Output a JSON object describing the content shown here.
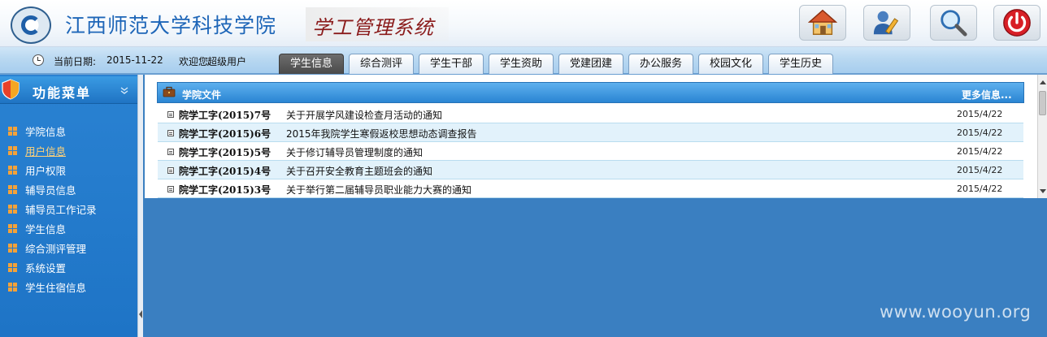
{
  "header": {
    "title_main": "江西师范大学科技学院",
    "title_sub": "学工管理系统",
    "buttons": [
      {
        "icon": "home-icon"
      },
      {
        "icon": "user-edit-icon"
      },
      {
        "icon": "search-icon"
      },
      {
        "icon": "power-icon"
      }
    ]
  },
  "status": {
    "date_label": "当前日期:",
    "date_value": "2015-11-22",
    "welcome_label": "欢迎您:",
    "welcome_user": "超级用户"
  },
  "tabs": [
    {
      "label": "学生信息",
      "active": true
    },
    {
      "label": "综合测评",
      "active": false
    },
    {
      "label": "学生干部",
      "active": false
    },
    {
      "label": "学生资助",
      "active": false
    },
    {
      "label": "党建团建",
      "active": false
    },
    {
      "label": "办公服务",
      "active": false
    },
    {
      "label": "校园文化",
      "active": false
    },
    {
      "label": "学生历史",
      "active": false
    }
  ],
  "sidebar": {
    "title": "功能菜单",
    "items": [
      {
        "label": "学院信息"
      },
      {
        "label": "用户信息",
        "selected": true
      },
      {
        "label": "用户权限"
      },
      {
        "label": "辅导员信息"
      },
      {
        "label": "辅导员工作记录"
      },
      {
        "label": "学生信息"
      },
      {
        "label": "综合测评管理"
      },
      {
        "label": "系统设置"
      },
      {
        "label": "学生住宿信息"
      }
    ]
  },
  "panel": {
    "title": "学院文件",
    "more": "更多信息...",
    "rows": [
      {
        "num": "院学工字(2015)7号",
        "title": "关于开展学风建设检查月活动的通知",
        "date": "2015/4/22"
      },
      {
        "num": "院学工字(2015)6号",
        "title": "2015年我院学生寒假返校思想动态调查报告",
        "date": "2015/4/22"
      },
      {
        "num": "院学工字(2015)5号",
        "title": "关于修订辅导员管理制度的通知",
        "date": "2015/4/22"
      },
      {
        "num": "院学工字(2015)4号",
        "title": "关于召开安全教育主题班会的通知",
        "date": "2015/4/22"
      },
      {
        "num": "院学工字(2015)3号",
        "title": "关于举行第二届辅导员职业能力大赛的通知",
        "date": "2015/4/22"
      }
    ]
  },
  "watermark": "www.wooyun.org",
  "colors": {
    "accent_blue": "#2a85d3",
    "sidebar_blue": "#1e74c6",
    "menu_bullet": "#f3a23a",
    "selected_link": "#ffd27a",
    "title_red": "#8a1a1a"
  }
}
